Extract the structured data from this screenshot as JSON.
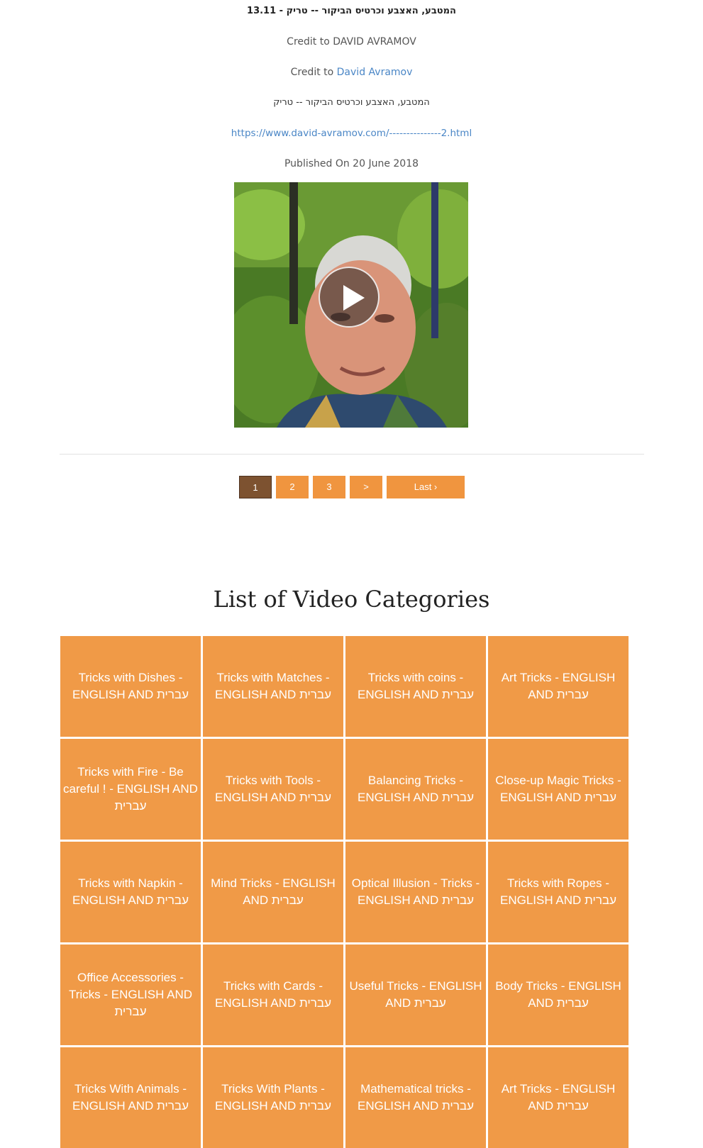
{
  "post": {
    "title": "13.11 - המטבע, האצבע וכרטיס הביקור -- טריק",
    "credit_plain": "Credit to DAVID AVRAMOV",
    "credit_prefix": "Credit to",
    "credit_link": "David Avramov",
    "hebrew_line": "המטבע, האצבע וכרטיס הביקור -- טריק",
    "url": "https://www.david-avramov.com/---------------2.html",
    "published": "Published On 20 June 2018"
  },
  "video": {
    "play_icon": "play-icon"
  },
  "pagination": {
    "pages": [
      "1",
      "2",
      "3"
    ],
    "active": "1",
    "next_label": ">",
    "last_label": "Last ›"
  },
  "categories_section": {
    "title": "List of Video Categories",
    "items": [
      "Tricks with Dishes - ENGLISH AND עברית",
      "Tricks with Matches - ENGLISH AND עברית",
      "Tricks with coins - ENGLISH AND עברית",
      "Art Tricks - ENGLISH AND עברית",
      "Tricks with Fire - Be careful ! - ENGLISH AND עברית",
      "Tricks with Tools - ENGLISH AND עברית",
      "Balancing Tricks - ENGLISH AND עברית",
      "Close-up Magic Tricks - ENGLISH AND עברית",
      "Tricks with Napkin - ENGLISH AND עברית",
      "Mind Tricks - ENGLISH AND עברית",
      "Optical Illusion - Tricks - ENGLISH AND עברית",
      "Tricks with Ropes - ENGLISH AND עברית",
      "Office Accessories - Tricks - ENGLISH AND עברית",
      "Tricks with Cards - ENGLISH AND עברית",
      "Useful Tricks - ENGLISH AND עברית",
      "Body Tricks - ENGLISH AND עברית",
      "Tricks With Animals - ENGLISH AND עברית",
      "Tricks With Plants - ENGLISH AND עברית",
      "Mathematical tricks - ENGLISH AND עברית",
      "Art Tricks - ENGLISH AND עברית"
    ]
  },
  "colors": {
    "tile": "#f09a47",
    "pager": "#f0953f",
    "pager_active": "#7d5230",
    "link": "#4a86c6"
  }
}
